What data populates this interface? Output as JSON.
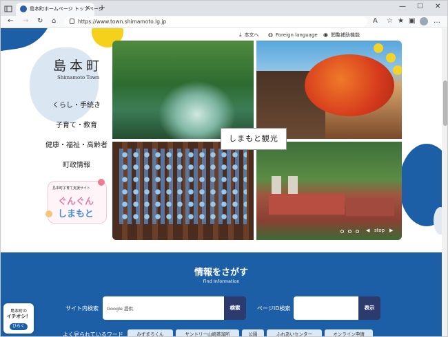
{
  "browser": {
    "tab_title": "島本町ホームページ トップページ",
    "tab_close": "×",
    "new_tab": "+",
    "minimize": "—",
    "maximize": "☐",
    "close": "✕",
    "url": "https://www.town.shimamoto.lg.jp"
  },
  "header": {
    "utility": {
      "text_only": "本文へ",
      "foreign_language": "Foreign language",
      "reading_aid": "閲覧補助機能"
    },
    "logo_jp": "島本町",
    "logo_en": "Shimamoto Town"
  },
  "global_nav": [
    "くらし・手続き",
    "子育て・教育",
    "健康・福祉・高齢者",
    "町政情報"
  ],
  "banner": {
    "subtitle": "島本町子育て支援サイト",
    "line1": "ぐんぐん",
    "line2": "しまもと"
  },
  "hero": {
    "label": "しまもと観光",
    "prev": "◀",
    "stop": "stop",
    "next": "▶"
  },
  "find": {
    "title": "情報をさがす",
    "subtitle": "Find Information",
    "site_search_label": "サイト内検索",
    "site_search_placeholder": "Google 提供",
    "site_search_button": "検索",
    "page_id_label": "ページID検索",
    "page_id_button": "表示",
    "popular_label": "よく見られているワード",
    "tags": [
      "みずまろくん",
      "サントリー山崎蒸溜所",
      "公園",
      "ふれあいセンター",
      "オンライン申請"
    ]
  },
  "float_widget": {
    "line1": "島本町の",
    "line2": "イチオシ！",
    "button": "ひらく"
  },
  "colors": {
    "brand_blue": "#1c5fa6",
    "accent_yellow": "#f6d11c",
    "button_navy": "#2c3a6e"
  }
}
